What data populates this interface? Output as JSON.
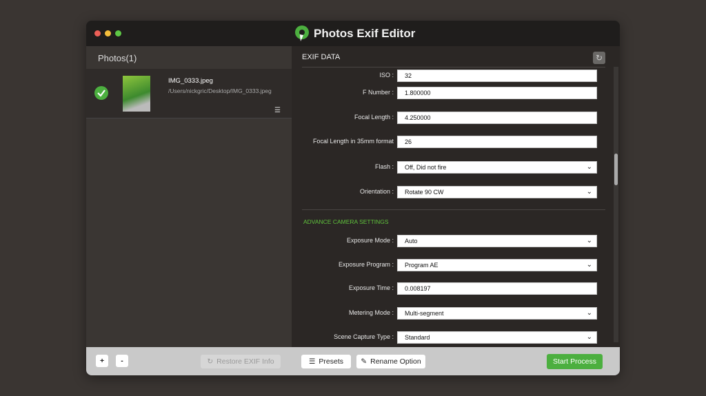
{
  "app": {
    "title": "Photos Exif Editor"
  },
  "left": {
    "title": "Photos(1)",
    "photo": {
      "name": "IMG_0333.jpeg",
      "path": "/Users/nickgric/Desktop/IMG_0333.jpeg"
    }
  },
  "right": {
    "title": "EXIF DATA",
    "fields": [
      {
        "label": "ISO :",
        "value": "32"
      },
      {
        "label": "F Number :",
        "value": "1.800000"
      },
      {
        "label": "Focal Length :",
        "value": "4.250000"
      },
      {
        "label": "Focal Length in 35mm format",
        "value": "26"
      },
      {
        "label": "Flash :",
        "value": "Off, Did not fire",
        "dropdown": true
      },
      {
        "label": "Orientation :",
        "value": "Rotate 90 CW",
        "dropdown": true
      }
    ],
    "section": "ADVANCE CAMERA SETTINGS",
    "advanced": [
      {
        "label": "Exposure Mode :",
        "value": "Auto",
        "dropdown": true
      },
      {
        "label": "Exposure Program :",
        "value": "Program AE",
        "dropdown": true
      },
      {
        "label": "Exposure Time :",
        "value": "0.008197"
      },
      {
        "label": "Metering Mode :",
        "value": "Multi-segment",
        "dropdown": true
      },
      {
        "label": "Scene Capture Type :",
        "value": "Standard",
        "dropdown": true
      }
    ]
  },
  "bottom": {
    "add": "+",
    "remove": "-",
    "restore": "Restore EXIF Info",
    "presets": "Presets",
    "rename": "Rename Option",
    "start": "Start Process"
  },
  "colors": {
    "accent": "#4caf3f"
  }
}
